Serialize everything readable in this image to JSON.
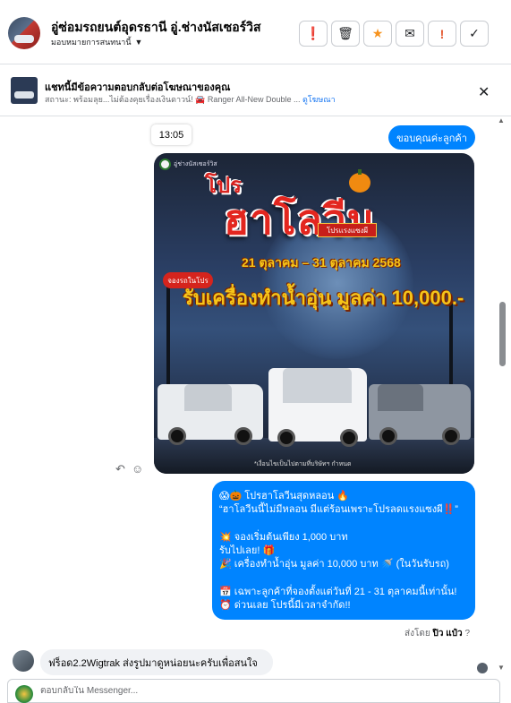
{
  "header": {
    "page_name": "อู่ซ่อมรถยนต์อุดรธานี อู่.ช่างนัสเซอร์วิส",
    "assign_label": "มอบหมายการสนทนานี้",
    "tools": [
      {
        "icon": "alert-circle-icon",
        "glyph": "❗"
      },
      {
        "icon": "trash-icon",
        "glyph": "🗑"
      },
      {
        "icon": "star-icon",
        "glyph": "★"
      },
      {
        "icon": "mail-icon",
        "glyph": "✉"
      },
      {
        "icon": "exclamation-icon",
        "glyph": "!"
      },
      {
        "icon": "check-icon",
        "glyph": "✓"
      }
    ]
  },
  "ad_banner": {
    "title": "แชทนี้มีข้อความตอบกลับต่อโฆษณาของคุณ",
    "status_line": "สถานะ: พร้อมลุย...ไม่ต้องคุยเรื่องเงินดาวน์! 🚘 Ranger All-New Double ...",
    "view_ad_link": "ดูโฆษณา",
    "close_glyph": "✕"
  },
  "thread": {
    "timestamp": "13:05",
    "sent_message_1": "ขอบคุณค่ะลูกค้า",
    "poster": {
      "brand": "อู่ช่างนัสเซอร์วิส",
      "title_line1": "โปร",
      "title_line2": "ฮาโลวีน",
      "tag": "โปรแรงแซงผี",
      "date_range": "21 ตุลาคม – 31 ตุลาคม 2568",
      "booking_label": "จองรถในโปร",
      "prize": "รับเครื่องทำน้ำอุ่น มูลค่า 10,000.-",
      "note": "*เงื่อนไขเป็นไปตามที่บริษัทฯ กำหนด"
    },
    "reply_icon_glyph": "↶",
    "emoji_icon_glyph": "☺",
    "sent_message_2_lines": [
      "😱🎃 โปรฮาโลวีนสุดหลอน 🔥",
      "“ฮาโลวีนนี้ไม่มีหลอน มีแต่ร้อนเพราะโปรลดแรงแซงผี‼️”",
      "",
      "💥 จองเริ่มต้นเพียง 1,000 บาท",
      "รับไปเลย! 🎁",
      "🎉 เครื่องทำน้ำอุ่น มูลค่า 10,000 บาท 🚿 (ในวันรับรถ)",
      "",
      "📅 เฉพาะลูกค้าที่จองตั้งแต่วันที่ 21 - 31 ตุลาคมนี้เท่านั้น!",
      "⏰ ด่วนเลย โปรนี้มีเวลาจำกัด!!"
    ],
    "sent_by_label": "ส่งโดย",
    "sent_by_name": "ปิว แป๋ว",
    "info_glyph": "?",
    "received_message": "ฟร็อด2.2Wigtrak ส่งรูปมาดูหน่อยนะครับเพื่อสนใจ"
  },
  "composer": {
    "placeholder": "ตอบกลับใน Messenger..."
  },
  "scrollbar": {
    "up_glyph": "▲",
    "down_glyph": "▼"
  }
}
